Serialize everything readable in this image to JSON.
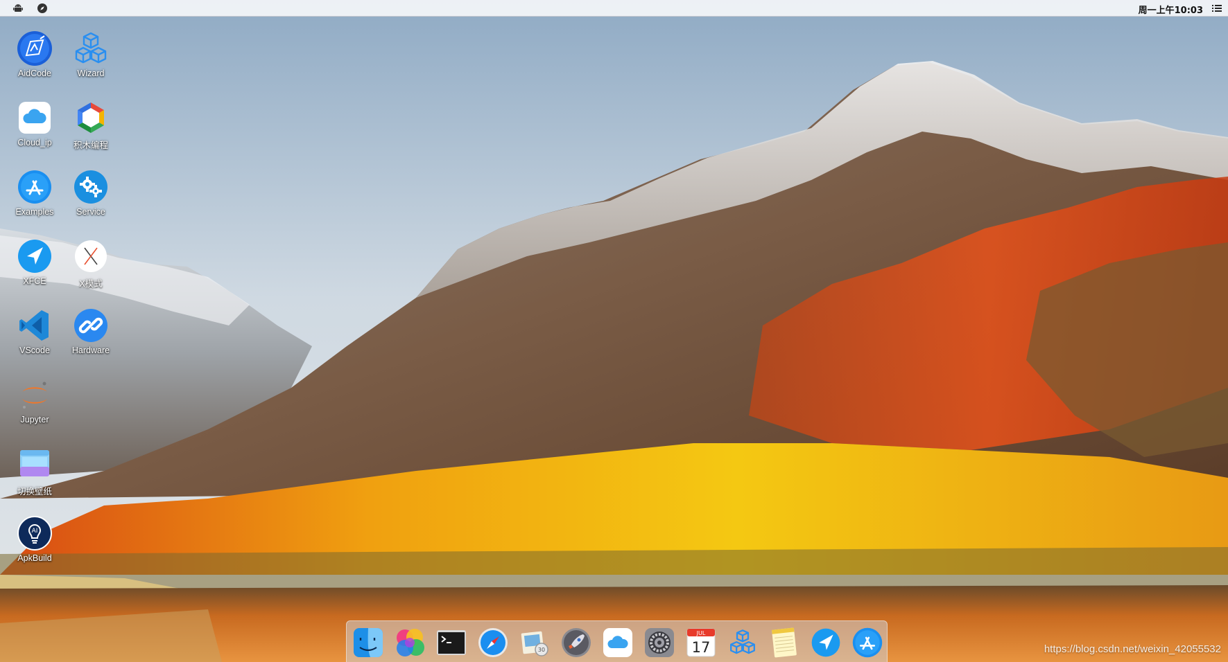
{
  "menubar": {
    "left_icons": [
      "android-icon",
      "compass-icon"
    ],
    "clock": "周一上午10:03",
    "menu_icon": "list-icon"
  },
  "desktop_icons": [
    {
      "id": "aidcode",
      "label": "AidCode",
      "icon": "aidcode-icon"
    },
    {
      "id": "wizard",
      "label": "Wizard",
      "icon": "cubes-icon"
    },
    {
      "id": "cloud-ip",
      "label": "Cloud_ip",
      "icon": "cloud-icon"
    },
    {
      "id": "blockly",
      "label": "积木编程",
      "icon": "blockly-icon"
    },
    {
      "id": "examples",
      "label": "Examples",
      "icon": "app-store-icon"
    },
    {
      "id": "service",
      "label": "Service",
      "icon": "gears-icon"
    },
    {
      "id": "xfce",
      "label": "XFCE",
      "icon": "paper-plane-icon"
    },
    {
      "id": "xmode",
      "label": "X模式",
      "icon": "x-icon"
    },
    {
      "id": "vscode",
      "label": "VScode",
      "icon": "vscode-icon"
    },
    {
      "id": "hardware",
      "label": "Hardware",
      "icon": "link-icon"
    },
    {
      "id": "jupyter",
      "label": "Jupyter",
      "icon": "jupyter-icon"
    },
    {
      "id": "wallpaper",
      "label": "切换壁纸",
      "icon": "wallpaper-icon"
    },
    {
      "id": "apkbuild",
      "label": "ApkBuild",
      "icon": "bulb-icon"
    }
  ],
  "dock": [
    {
      "id": "finder",
      "icon": "finder-icon"
    },
    {
      "id": "photos",
      "icon": "color-balls-icon"
    },
    {
      "id": "terminal",
      "icon": "terminal-icon"
    },
    {
      "id": "safari",
      "icon": "safari-icon"
    },
    {
      "id": "preview",
      "icon": "preview-icon"
    },
    {
      "id": "launchpad",
      "icon": "rocket-icon"
    },
    {
      "id": "icloud",
      "icon": "cloud-icon"
    },
    {
      "id": "settings",
      "icon": "gear-icon"
    },
    {
      "id": "calendar",
      "icon": "calendar-icon",
      "month": "JUL",
      "day": "17"
    },
    {
      "id": "wizard",
      "icon": "cubes-icon"
    },
    {
      "id": "notes",
      "icon": "notes-icon"
    },
    {
      "id": "xfce",
      "icon": "paper-plane-icon"
    },
    {
      "id": "appstore",
      "icon": "app-store-icon"
    }
  ],
  "watermark": "https://blog.csdn.net/weixin_42055532",
  "colors": {
    "icon_blue": "#2a8ff0",
    "sky_top": "#9fb8cf",
    "menubar_bg": "#f5f6f8"
  }
}
